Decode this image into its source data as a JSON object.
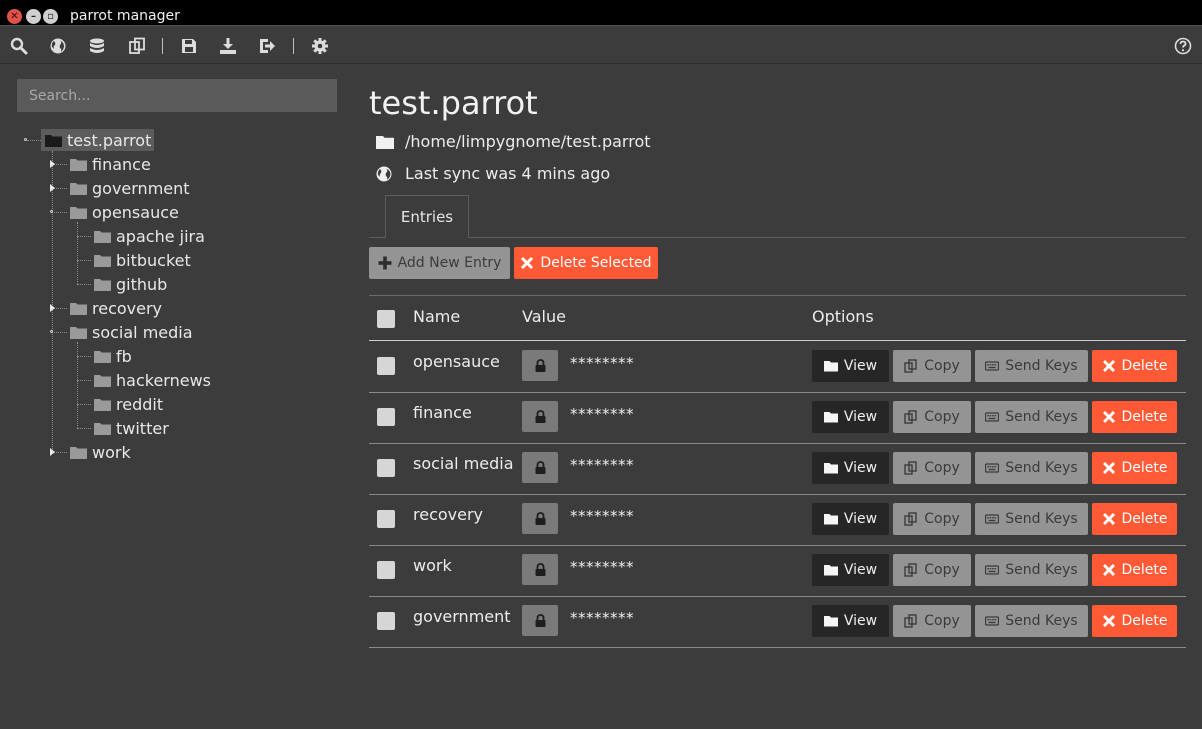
{
  "window": {
    "title": "parrot manager"
  },
  "toolbar": {
    "icons": [
      "search-icon",
      "globe-icon",
      "database-icon",
      "clone-icon",
      "save-icon",
      "download-icon",
      "sign-out-icon",
      "gear-icon",
      "help-icon"
    ]
  },
  "search": {
    "placeholder": "Search...",
    "value": ""
  },
  "tree": {
    "root": "test.parrot",
    "items": [
      {
        "label": "finance"
      },
      {
        "label": "government"
      },
      {
        "label": "opensauce",
        "children": [
          "apache jira",
          "bitbucket",
          "github"
        ]
      },
      {
        "label": "recovery"
      },
      {
        "label": "social media",
        "children": [
          "fb",
          "hackernews",
          "reddit",
          "twitter"
        ]
      },
      {
        "label": "work"
      }
    ]
  },
  "main": {
    "title": "test.parrot",
    "path": "/home/limpygnome/test.parrot",
    "sync": "Last sync was 4 mins ago",
    "tab": "Entries",
    "add_label": "Add New Entry",
    "delete_selected_label": "Delete Selected",
    "columns": {
      "name": "Name",
      "value": "Value",
      "options": "Options"
    },
    "actions": {
      "view": "View",
      "copy": "Copy",
      "send_keys": "Send Keys",
      "delete": "Delete"
    },
    "entries": [
      {
        "name": "opensauce",
        "value": "********"
      },
      {
        "name": "finance",
        "value": "********"
      },
      {
        "name": "social media",
        "value": "********"
      },
      {
        "name": "recovery",
        "value": "********"
      },
      {
        "name": "work",
        "value": "********"
      },
      {
        "name": "government",
        "value": "********"
      }
    ]
  },
  "colors": {
    "accent_red": "#ff5a35",
    "button_grey": "#949494",
    "button_dark": "#262626",
    "background": "#3c3c3c"
  }
}
